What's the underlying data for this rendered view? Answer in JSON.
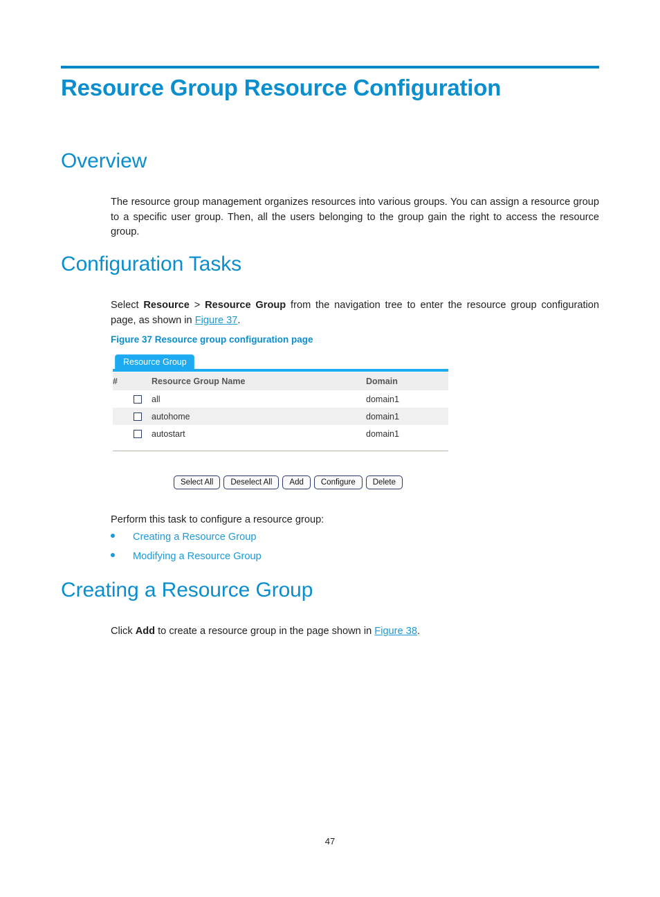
{
  "document": {
    "title": "Resource Group Resource Configuration",
    "page_number": "47"
  },
  "sections": {
    "overview": {
      "heading": "Overview",
      "paragraph": "The resource group management organizes resources into various groups. You can assign a resource group to a specific user group. Then, all the users belonging to the group gain the right to access the resource group."
    },
    "configuration_tasks": {
      "heading": "Configuration Tasks",
      "intro_prefix": "Select ",
      "intro_bold_1": "Resource",
      "intro_sep": " > ",
      "intro_bold_2": "Resource Group",
      "intro_mid": " from the navigation tree to enter the resource group configuration page, as shown in ",
      "intro_link": "Figure 37",
      "intro_suffix": ".",
      "figure_caption": "Figure 37 Resource group configuration page",
      "perform_text": "Perform this task to configure a resource group:",
      "task_links": [
        "Creating a Resource Group",
        "Modifying a Resource Group"
      ]
    },
    "creating_resource_group": {
      "heading": "Creating a Resource Group",
      "click_prefix": "Click ",
      "click_bold": "Add",
      "click_mid": " to create a resource group in the page shown in ",
      "click_link": "Figure 38",
      "click_suffix": "."
    }
  },
  "figure37": {
    "tab_label": "Resource Group",
    "table": {
      "columns": [
        "#",
        "Resource Group Name",
        "Domain"
      ],
      "rows": [
        {
          "checked": false,
          "name": "all",
          "domain": "domain1"
        },
        {
          "checked": false,
          "name": "autohome",
          "domain": "domain1"
        },
        {
          "checked": false,
          "name": "autostart",
          "domain": "domain1"
        }
      ]
    },
    "buttons": [
      "Select All",
      "Deselect All",
      "Add",
      "Configure",
      "Delete"
    ]
  },
  "colors": {
    "heading_blue": "#0b8ecd",
    "rule_blue": "#0089c4",
    "link_blue": "#1b9ad6",
    "tab_blue": "#1eaaf0",
    "header_gray": "#eeeeee",
    "alt_row_gray": "#f0f0f0"
  }
}
